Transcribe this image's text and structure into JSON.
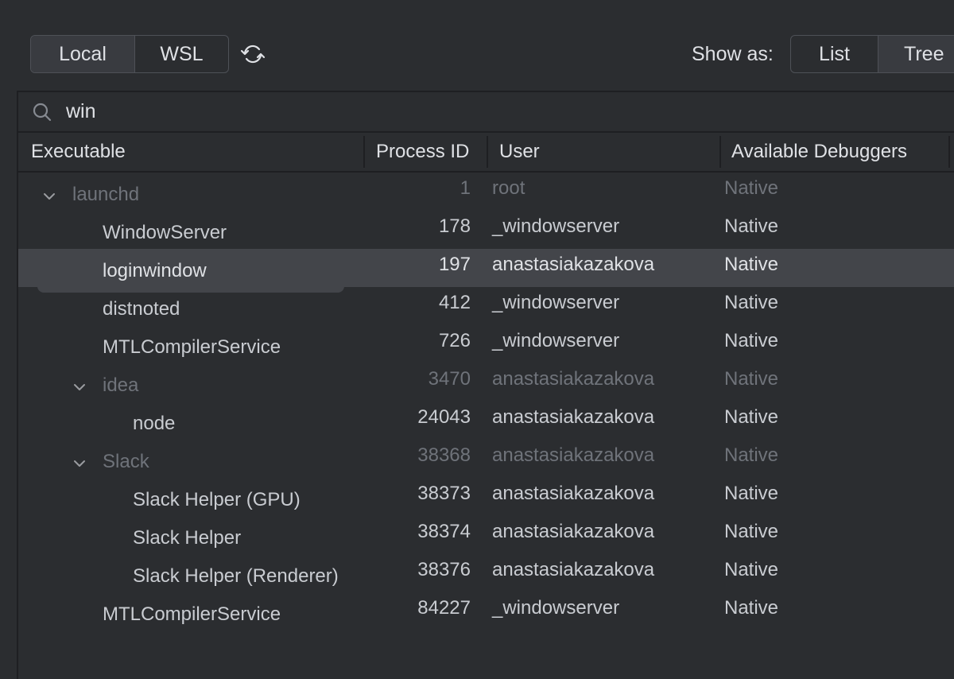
{
  "toolbar": {
    "source_options": [
      {
        "label": "Local",
        "selected": true
      },
      {
        "label": "WSL",
        "selected": false
      }
    ],
    "refresh_icon": "refresh-icon",
    "show_as_label": "Show as:",
    "view_options": [
      {
        "label": "List",
        "selected": false
      },
      {
        "label": "Tree",
        "selected": true
      }
    ]
  },
  "search": {
    "icon": "search-icon",
    "value": "win"
  },
  "table": {
    "columns": [
      "Executable",
      "Process ID",
      "User",
      "Available Debuggers"
    ],
    "rows": [
      {
        "executable": "launchd",
        "pid": "1",
        "user": "root",
        "debugger": "Native",
        "depth": 0,
        "expanded": true,
        "dim": true
      },
      {
        "executable": "WindowServer",
        "pid": "178",
        "user": "_windowserver",
        "debugger": "Native",
        "depth": 1,
        "dim": false
      },
      {
        "executable": "loginwindow",
        "pid": "197",
        "user": "anastasiakazakova",
        "debugger": "Native",
        "depth": 1,
        "dim": false,
        "selected": true
      },
      {
        "executable": "distnoted",
        "pid": "412",
        "user": "_windowserver",
        "debugger": "Native",
        "depth": 1,
        "dim": false
      },
      {
        "executable": "MTLCompilerService",
        "pid": "726",
        "user": "_windowserver",
        "debugger": "Native",
        "depth": 1,
        "dim": false
      },
      {
        "executable": "idea",
        "pid": "3470",
        "user": "anastasiakazakova",
        "debugger": "Native",
        "depth": 1,
        "expanded": true,
        "dim": true
      },
      {
        "executable": "node",
        "pid": "24043",
        "user": "anastasiakazakova",
        "debugger": "Native",
        "depth": 2,
        "dim": false
      },
      {
        "executable": "Slack",
        "pid": "38368",
        "user": "anastasiakazakova",
        "debugger": "Native",
        "depth": 1,
        "expanded": true,
        "dim": true
      },
      {
        "executable": "Slack Helper (GPU)",
        "pid": "38373",
        "user": "anastasiakazakova",
        "debugger": "Native",
        "depth": 2,
        "dim": false
      },
      {
        "executable": "Slack Helper",
        "pid": "38374",
        "user": "anastasiakazakova",
        "debugger": "Native",
        "depth": 2,
        "dim": false
      },
      {
        "executable": "Slack Helper (Renderer)",
        "pid": "38376",
        "user": "anastasiakazakova",
        "debugger": "Native",
        "depth": 2,
        "dim": false
      },
      {
        "executable": "MTLCompilerService",
        "pid": "84227",
        "user": "_windowserver",
        "debugger": "Native",
        "depth": 1,
        "dim": false
      }
    ]
  }
}
